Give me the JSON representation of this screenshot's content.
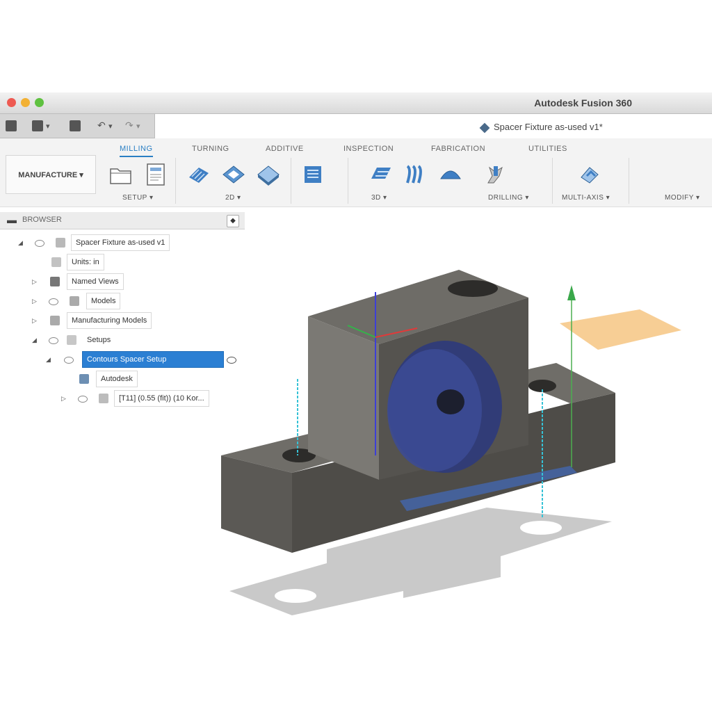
{
  "window": {
    "app_title": "Autodesk Fusion 360",
    "document_tab": "Spacer Fixture as-used v1*"
  },
  "workspace": {
    "label": "MANUFACTURE ▾"
  },
  "ribbon": {
    "tabs": [
      "MILLING",
      "TURNING",
      "ADDITIVE",
      "INSPECTION",
      "FABRICATION",
      "UTILITIES"
    ],
    "active_tab": "MILLING",
    "groups": [
      "SETUP ▾",
      "2D ▾",
      "3D ▾",
      "DRILLING ▾",
      "MULTI-AXIS ▾",
      "MODIFY ▾"
    ]
  },
  "browser": {
    "header": "BROWSER",
    "root": "Spacer Fixture as-used v1",
    "items": [
      "Units: in",
      "Named Views",
      "Models",
      "Manufacturing Models",
      "Setups",
      "Contours Spacer Setup",
      "Autodesk",
      "[T11] (0.55 (fit)) (10 Kor..."
    ]
  },
  "colors": {
    "accent": "#2a7fc4",
    "selection": "#2b7fd3",
    "part": "#5e5c57",
    "sketch_plane": "#f6c98a"
  },
  "icons": [
    "folder-icon",
    "setup-sheet-icon",
    "adaptive-clearing-icon",
    "pocket-icon",
    "face-icon",
    "2d-contour-icon",
    "3d-adaptive-icon",
    "3d-pocket-icon",
    "scallop-icon",
    "drill-icon",
    "multi-axis-icon"
  ]
}
